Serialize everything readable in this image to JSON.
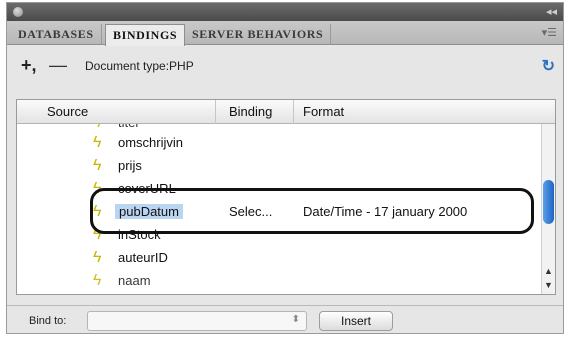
{
  "tabs": [
    "DATABASES",
    "BINDINGS",
    "SERVER BEHAVIORS"
  ],
  "toolbar": {
    "add_label": "+,",
    "remove_label": "—",
    "doc_type": "Document type:PHP",
    "refresh_icon": "refresh-icon"
  },
  "table": {
    "headers": {
      "source": "Source",
      "binding": "Binding",
      "format": "Format"
    },
    "rows": [
      {
        "name": "titel",
        "binding": "",
        "format": ""
      },
      {
        "name": "omschrijvin",
        "binding": "",
        "format": ""
      },
      {
        "name": "prijs",
        "binding": "",
        "format": ""
      },
      {
        "name": "coverURL",
        "binding": "",
        "format": ""
      },
      {
        "name": "pubDatum",
        "binding": "Selec...",
        "format": "Date/Time - 17 january 2000"
      },
      {
        "name": "inStock",
        "binding": "",
        "format": ""
      },
      {
        "name": "auteurID",
        "binding": "",
        "format": ""
      },
      {
        "name": "naam",
        "binding": "",
        "format": ""
      }
    ]
  },
  "footer": {
    "bind_to_label": "Bind to:",
    "insert_label": "Insert"
  },
  "colors": {
    "selection": "#b9d5f2",
    "scroll_thumb": "#1e64c6",
    "bolt": "#c9b400"
  }
}
